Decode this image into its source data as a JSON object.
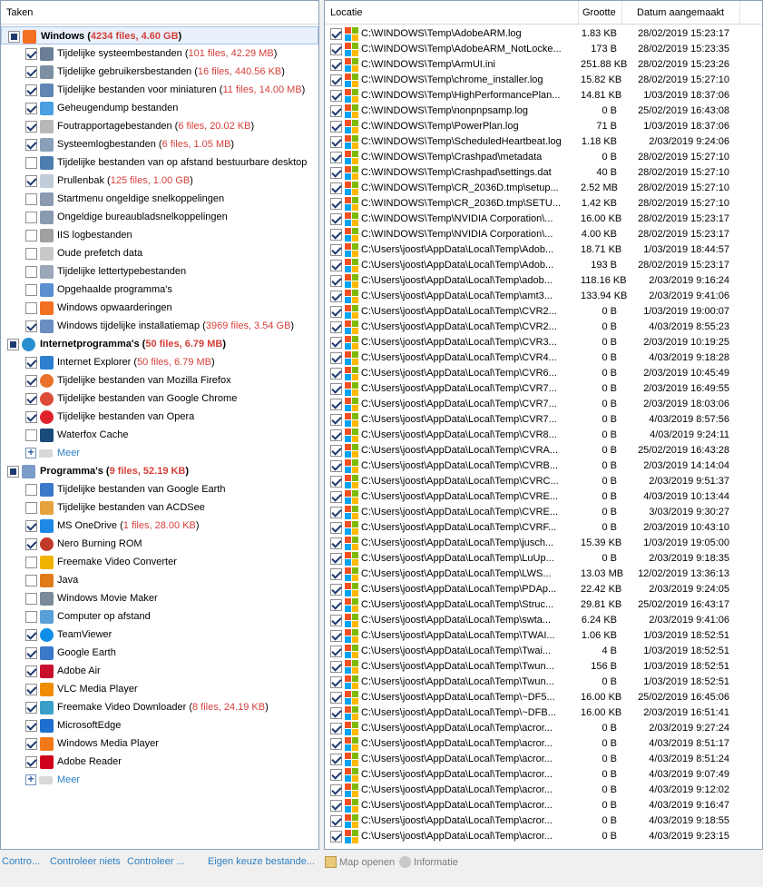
{
  "left_panel": {
    "header": "Taken",
    "rows": [
      {
        "kind": "group",
        "check": "partial",
        "icon": "windows-flag-icon",
        "color": "#f36f21",
        "label": "Windows",
        "stats": "4234 files, 4.60 GB",
        "selected": true
      },
      {
        "kind": "item",
        "check": "checked",
        "icon": "system-files-icon",
        "color": "#6a7f96",
        "label": "Tijdelijke systeembestanden",
        "stats": "101 files, 42.29 MB"
      },
      {
        "kind": "item",
        "check": "checked",
        "icon": "user-files-icon",
        "color": "#7e8fa3",
        "label": "Tijdelijke gebruikersbestanden",
        "stats": "16 files, 440.56 KB"
      },
      {
        "kind": "item",
        "check": "checked",
        "icon": "thumbnails-icon",
        "color": "#5f86b5",
        "label": "Tijdelijke bestanden voor miniaturen",
        "stats": "11 files, 14.00 MB"
      },
      {
        "kind": "item",
        "check": "checked",
        "icon": "memory-dump-icon",
        "color": "#4aa0e0",
        "label": "Geheugendump bestanden",
        "stats": ""
      },
      {
        "kind": "item",
        "check": "checked",
        "icon": "error-report-icon",
        "color": "#b8b8b8",
        "label": "Foutrapportagebestanden",
        "stats": "6 files, 20.02 KB"
      },
      {
        "kind": "item",
        "check": "checked",
        "icon": "system-log-icon",
        "color": "#8aa0b8",
        "label": "Systeemlogbestanden",
        "stats": "6 files, 1.05 MB"
      },
      {
        "kind": "item",
        "check": "unchecked",
        "icon": "remote-desktop-icon",
        "color": "#4e7eb0",
        "label": "Tijdelijke bestanden van op afstand bestuurbare desktop",
        "stats": ""
      },
      {
        "kind": "item",
        "check": "checked",
        "icon": "recycle-bin-icon",
        "color": "#c0cdd8",
        "label": "Prullenbak",
        "stats": "125 files, 1.00 GB"
      },
      {
        "kind": "item",
        "check": "unchecked",
        "icon": "start-menu-icon",
        "color": "#8a9bb0",
        "label": "Startmenu ongeldige snelkoppelingen",
        "stats": ""
      },
      {
        "kind": "item",
        "check": "unchecked",
        "icon": "desktop-shortcut-icon",
        "color": "#8a9bb0",
        "label": "Ongeldige bureaubladsnelkoppelingen",
        "stats": ""
      },
      {
        "kind": "item",
        "check": "unchecked",
        "icon": "iis-log-icon",
        "color": "#a0a0a0",
        "label": "IIS logbestanden",
        "stats": ""
      },
      {
        "kind": "item",
        "check": "unchecked",
        "icon": "prefetch-icon",
        "color": "#c8c8c8",
        "label": "Oude prefetch data",
        "stats": ""
      },
      {
        "kind": "item",
        "check": "unchecked",
        "icon": "font-file-icon",
        "color": "#9aa8b8",
        "label": "Tijdelijke lettertypebestanden",
        "stats": ""
      },
      {
        "kind": "item",
        "check": "unchecked",
        "icon": "downloaded-programs-icon",
        "color": "#5a8fd0",
        "label": "Opgehaalde programma's",
        "stats": ""
      },
      {
        "kind": "item",
        "check": "unchecked",
        "icon": "windows-upgrade-icon",
        "color": "#f36f21",
        "label": "Windows opwaarderingen",
        "stats": ""
      },
      {
        "kind": "item",
        "check": "checked",
        "icon": "installer-icon",
        "color": "#6a8fc0",
        "label": "Windows tijdelijke installatiemap",
        "stats": "3969 files, 3.54 GB"
      },
      {
        "kind": "group",
        "check": "partial",
        "icon": "globe-icon",
        "color": "#2a8fd0",
        "label": "Internetprogramma's",
        "stats": "50 files, 6.79 MB",
        "selected": false
      },
      {
        "kind": "item",
        "check": "checked",
        "icon": "internet-explorer-icon",
        "color": "#2d7fd0",
        "label": "Internet Explorer",
        "stats": "50 files, 6.79 MB"
      },
      {
        "kind": "item",
        "check": "checked",
        "icon": "firefox-icon",
        "color": "#e8702a",
        "label": "Tijdelijke bestanden van Mozilla Firefox",
        "stats": ""
      },
      {
        "kind": "item",
        "check": "checked",
        "icon": "chrome-icon",
        "color": "#dd4b39",
        "label": "Tijdelijke bestanden van Google Chrome",
        "stats": ""
      },
      {
        "kind": "item",
        "check": "checked",
        "icon": "opera-icon",
        "color": "#e0222d",
        "label": "Tijdelijke bestanden van Opera",
        "stats": ""
      },
      {
        "kind": "item",
        "check": "unchecked",
        "icon": "waterfox-icon",
        "color": "#1a4a7a",
        "label": "Waterfox Cache",
        "stats": ""
      },
      {
        "kind": "more",
        "label": "Meer"
      },
      {
        "kind": "group",
        "check": "partial",
        "icon": "programs-icon",
        "color": "#7a9cc8",
        "label": "Programma's",
        "stats": "9 files, 52.19 KB",
        "selected": false
      },
      {
        "kind": "item",
        "check": "unchecked",
        "icon": "google-earth-icon",
        "color": "#3a78c8",
        "label": "Tijdelijke bestanden van Google Earth",
        "stats": ""
      },
      {
        "kind": "item",
        "check": "unchecked",
        "icon": "acdsee-icon",
        "color": "#e6a23c",
        "label": "Tijdelijke bestanden van ACDSee",
        "stats": ""
      },
      {
        "kind": "item",
        "check": "checked",
        "icon": "onedrive-icon",
        "color": "#1e88e5",
        "label": "MS OneDrive",
        "stats": "1 files, 28.00 KB"
      },
      {
        "kind": "item",
        "check": "checked",
        "icon": "nero-icon",
        "color": "#c0392b",
        "label": "Nero Burning ROM",
        "stats": ""
      },
      {
        "kind": "item",
        "check": "unchecked",
        "icon": "freemake-video-converter-icon",
        "color": "#f0b400",
        "label": "Freemake Video Converter",
        "stats": ""
      },
      {
        "kind": "item",
        "check": "unchecked",
        "icon": "java-icon",
        "color": "#e07b1a",
        "label": "Java",
        "stats": ""
      },
      {
        "kind": "item",
        "check": "unchecked",
        "icon": "movie-maker-icon",
        "color": "#7a8a9a",
        "label": "Windows Movie Maker",
        "stats": ""
      },
      {
        "kind": "item",
        "check": "unchecked",
        "icon": "remote-computer-icon",
        "color": "#5aa0d8",
        "label": "Computer op afstand",
        "stats": ""
      },
      {
        "kind": "item",
        "check": "checked",
        "icon": "teamviewer-icon",
        "color": "#0e8ee9",
        "label": "TeamViewer",
        "stats": ""
      },
      {
        "kind": "item",
        "check": "checked",
        "icon": "google-earth-icon",
        "color": "#3a78c8",
        "label": "Google Earth",
        "stats": ""
      },
      {
        "kind": "item",
        "check": "checked",
        "icon": "adobe-air-icon",
        "color": "#c8102e",
        "label": "Adobe Air",
        "stats": ""
      },
      {
        "kind": "item",
        "check": "checked",
        "icon": "vlc-icon",
        "color": "#f08c00",
        "label": "VLC Media Player",
        "stats": ""
      },
      {
        "kind": "item",
        "check": "checked",
        "icon": "freemake-downloader-icon",
        "color": "#3aa0c8",
        "label": "Freemake Video Downloader",
        "stats": "8 files, 24.19 KB"
      },
      {
        "kind": "item",
        "check": "checked",
        "icon": "edge-icon",
        "color": "#1f6fd0",
        "label": "MicrosoftEdge",
        "stats": ""
      },
      {
        "kind": "item",
        "check": "checked",
        "icon": "media-player-icon",
        "color": "#f07a1a",
        "label": "Windows Media Player",
        "stats": ""
      },
      {
        "kind": "item",
        "check": "checked",
        "icon": "adobe-reader-icon",
        "color": "#d0021b",
        "label": "Adobe Reader",
        "stats": ""
      },
      {
        "kind": "more",
        "label": "Meer"
      }
    ]
  },
  "right_panel": {
    "columns": [
      "Locatie",
      "Grootte",
      "Datum aangemaakt"
    ],
    "files": [
      {
        "path": "C:\\WINDOWS\\Temp\\AdobeARM.log",
        "size": "1.83 KB",
        "date": "28/02/2019 15:23:17"
      },
      {
        "path": "C:\\WINDOWS\\Temp\\AdobeARM_NotLocke...",
        "size": "173 B",
        "date": "28/02/2019 15:23:35"
      },
      {
        "path": "C:\\WINDOWS\\Temp\\ArmUI.ini",
        "size": "251.88 KB",
        "date": "28/02/2019 15:23:26"
      },
      {
        "path": "C:\\WINDOWS\\Temp\\chrome_installer.log",
        "size": "15.82 KB",
        "date": "28/02/2019 15:27:10"
      },
      {
        "path": "C:\\WINDOWS\\Temp\\HighPerformancePlan...",
        "size": "14.81 KB",
        "date": "1/03/2019 18:37:06"
      },
      {
        "path": "C:\\WINDOWS\\Temp\\nonpnpsamp.log",
        "size": "0 B",
        "date": "25/02/2019 16:43:08"
      },
      {
        "path": "C:\\WINDOWS\\Temp\\PowerPlan.log",
        "size": "71 B",
        "date": "1/03/2019 18:37:06"
      },
      {
        "path": "C:\\WINDOWS\\Temp\\ScheduledHeartbeat.log",
        "size": "1.18 KB",
        "date": "2/03/2019 9:24:06"
      },
      {
        "path": "C:\\WINDOWS\\Temp\\Crashpad\\metadata",
        "size": "0 B",
        "date": "28/02/2019 15:27:10"
      },
      {
        "path": "C:\\WINDOWS\\Temp\\Crashpad\\settings.dat",
        "size": "40 B",
        "date": "28/02/2019 15:27:10"
      },
      {
        "path": "C:\\WINDOWS\\Temp\\CR_2036D.tmp\\setup...",
        "size": "2.52 MB",
        "date": "28/02/2019 15:27:10"
      },
      {
        "path": "C:\\WINDOWS\\Temp\\CR_2036D.tmp\\SETU...",
        "size": "1.42 KB",
        "date": "28/02/2019 15:27:10"
      },
      {
        "path": "C:\\WINDOWS\\Temp\\NVIDIA Corporation\\...",
        "size": "16.00 KB",
        "date": "28/02/2019 15:23:17"
      },
      {
        "path": "C:\\WINDOWS\\Temp\\NVIDIA Corporation\\...",
        "size": "4.00 KB",
        "date": "28/02/2019 15:23:17"
      },
      {
        "path": "C:\\Users\\joost\\AppData\\Local\\Temp\\Adob...",
        "size": "18.71 KB",
        "date": "1/03/2019 18:44:57"
      },
      {
        "path": "C:\\Users\\joost\\AppData\\Local\\Temp\\Adob...",
        "size": "193 B",
        "date": "28/02/2019 15:23:17"
      },
      {
        "path": "C:\\Users\\joost\\AppData\\Local\\Temp\\adob...",
        "size": "118.16 KB",
        "date": "2/03/2019 9:16:24"
      },
      {
        "path": "C:\\Users\\joost\\AppData\\Local\\Temp\\amt3...",
        "size": "133.94 KB",
        "date": "2/03/2019 9:41:06"
      },
      {
        "path": "C:\\Users\\joost\\AppData\\Local\\Temp\\CVR2...",
        "size": "0 B",
        "date": "1/03/2019 19:00:07"
      },
      {
        "path": "C:\\Users\\joost\\AppData\\Local\\Temp\\CVR2...",
        "size": "0 B",
        "date": "4/03/2019 8:55:23"
      },
      {
        "path": "C:\\Users\\joost\\AppData\\Local\\Temp\\CVR3...",
        "size": "0 B",
        "date": "2/03/2019 10:19:25"
      },
      {
        "path": "C:\\Users\\joost\\AppData\\Local\\Temp\\CVR4...",
        "size": "0 B",
        "date": "4/03/2019 9:18:28"
      },
      {
        "path": "C:\\Users\\joost\\AppData\\Local\\Temp\\CVR6...",
        "size": "0 B",
        "date": "2/03/2019 10:45:49"
      },
      {
        "path": "C:\\Users\\joost\\AppData\\Local\\Temp\\CVR7...",
        "size": "0 B",
        "date": "2/03/2019 16:49:55"
      },
      {
        "path": "C:\\Users\\joost\\AppData\\Local\\Temp\\CVR7...",
        "size": "0 B",
        "date": "2/03/2019 18:03:06"
      },
      {
        "path": "C:\\Users\\joost\\AppData\\Local\\Temp\\CVR7...",
        "size": "0 B",
        "date": "4/03/2019 8:57:56"
      },
      {
        "path": "C:\\Users\\joost\\AppData\\Local\\Temp\\CVR8...",
        "size": "0 B",
        "date": "4/03/2019 9:24:11"
      },
      {
        "path": "C:\\Users\\joost\\AppData\\Local\\Temp\\CVRA...",
        "size": "0 B",
        "date": "25/02/2019 16:43:28"
      },
      {
        "path": "C:\\Users\\joost\\AppData\\Local\\Temp\\CVRB...",
        "size": "0 B",
        "date": "2/03/2019 14:14:04"
      },
      {
        "path": "C:\\Users\\joost\\AppData\\Local\\Temp\\CVRC...",
        "size": "0 B",
        "date": "2/03/2019 9:51:37"
      },
      {
        "path": "C:\\Users\\joost\\AppData\\Local\\Temp\\CVRE...",
        "size": "0 B",
        "date": "4/03/2019 10:13:44"
      },
      {
        "path": "C:\\Users\\joost\\AppData\\Local\\Temp\\CVRE...",
        "size": "0 B",
        "date": "3/03/2019 9:30:27"
      },
      {
        "path": "C:\\Users\\joost\\AppData\\Local\\Temp\\CVRF...",
        "size": "0 B",
        "date": "2/03/2019 10:43:10"
      },
      {
        "path": "C:\\Users\\joost\\AppData\\Local\\Temp\\jusch...",
        "size": "15.39 KB",
        "date": "1/03/2019 19:05:00"
      },
      {
        "path": "C:\\Users\\joost\\AppData\\Local\\Temp\\LuUp...",
        "size": "0 B",
        "date": "2/03/2019 9:18:35"
      },
      {
        "path": "C:\\Users\\joost\\AppData\\Local\\Temp\\LWS...",
        "size": "13.03 MB",
        "date": "12/02/2019 13:36:13"
      },
      {
        "path": "C:\\Users\\joost\\AppData\\Local\\Temp\\PDAp...",
        "size": "22.42 KB",
        "date": "2/03/2019 9:24:05"
      },
      {
        "path": "C:\\Users\\joost\\AppData\\Local\\Temp\\Struc...",
        "size": "29.81 KB",
        "date": "25/02/2019 16:43:17"
      },
      {
        "path": "C:\\Users\\joost\\AppData\\Local\\Temp\\swta...",
        "size": "6.24 KB",
        "date": "2/03/2019 9:41:06"
      },
      {
        "path": "C:\\Users\\joost\\AppData\\Local\\Temp\\TWAI...",
        "size": "1.06 KB",
        "date": "1/03/2019 18:52:51"
      },
      {
        "path": "C:\\Users\\joost\\AppData\\Local\\Temp\\Twai...",
        "size": "4 B",
        "date": "1/03/2019 18:52:51"
      },
      {
        "path": "C:\\Users\\joost\\AppData\\Local\\Temp\\Twun...",
        "size": "156 B",
        "date": "1/03/2019 18:52:51"
      },
      {
        "path": "C:\\Users\\joost\\AppData\\Local\\Temp\\Twun...",
        "size": "0 B",
        "date": "1/03/2019 18:52:51"
      },
      {
        "path": "C:\\Users\\joost\\AppData\\Local\\Temp\\~DF5...",
        "size": "16.00 KB",
        "date": "25/02/2019 16:45:06"
      },
      {
        "path": "C:\\Users\\joost\\AppData\\Local\\Temp\\~DFB...",
        "size": "16.00 KB",
        "date": "2/03/2019 16:51:41"
      },
      {
        "path": "C:\\Users\\joost\\AppData\\Local\\Temp\\acror...",
        "size": "0 B",
        "date": "2/03/2019 9:27:24"
      },
      {
        "path": "C:\\Users\\joost\\AppData\\Local\\Temp\\acror...",
        "size": "0 B",
        "date": "4/03/2019 8:51:17"
      },
      {
        "path": "C:\\Users\\joost\\AppData\\Local\\Temp\\acror...",
        "size": "0 B",
        "date": "4/03/2019 8:51:24"
      },
      {
        "path": "C:\\Users\\joost\\AppData\\Local\\Temp\\acror...",
        "size": "0 B",
        "date": "4/03/2019 9:07:49"
      },
      {
        "path": "C:\\Users\\joost\\AppData\\Local\\Temp\\acror...",
        "size": "0 B",
        "date": "4/03/2019 9:12:02"
      },
      {
        "path": "C:\\Users\\joost\\AppData\\Local\\Temp\\acror...",
        "size": "0 B",
        "date": "4/03/2019 9:16:47"
      },
      {
        "path": "C:\\Users\\joost\\AppData\\Local\\Temp\\acror...",
        "size": "0 B",
        "date": "4/03/2019 9:18:55"
      },
      {
        "path": "C:\\Users\\joost\\AppData\\Local\\Temp\\acror...",
        "size": "0 B",
        "date": "4/03/2019 9:23:15"
      }
    ]
  },
  "bottom_bar": {
    "links": [
      "Contro...",
      "Controleer niets",
      "Controleer ...",
      "Eigen keuze bestande..."
    ],
    "open_folder_label": "Map openen",
    "info_label": "Informatie"
  },
  "colors": {
    "stats": "#d43f3a",
    "link": "#2e7fc1",
    "disabled": "#7a7a7a"
  }
}
